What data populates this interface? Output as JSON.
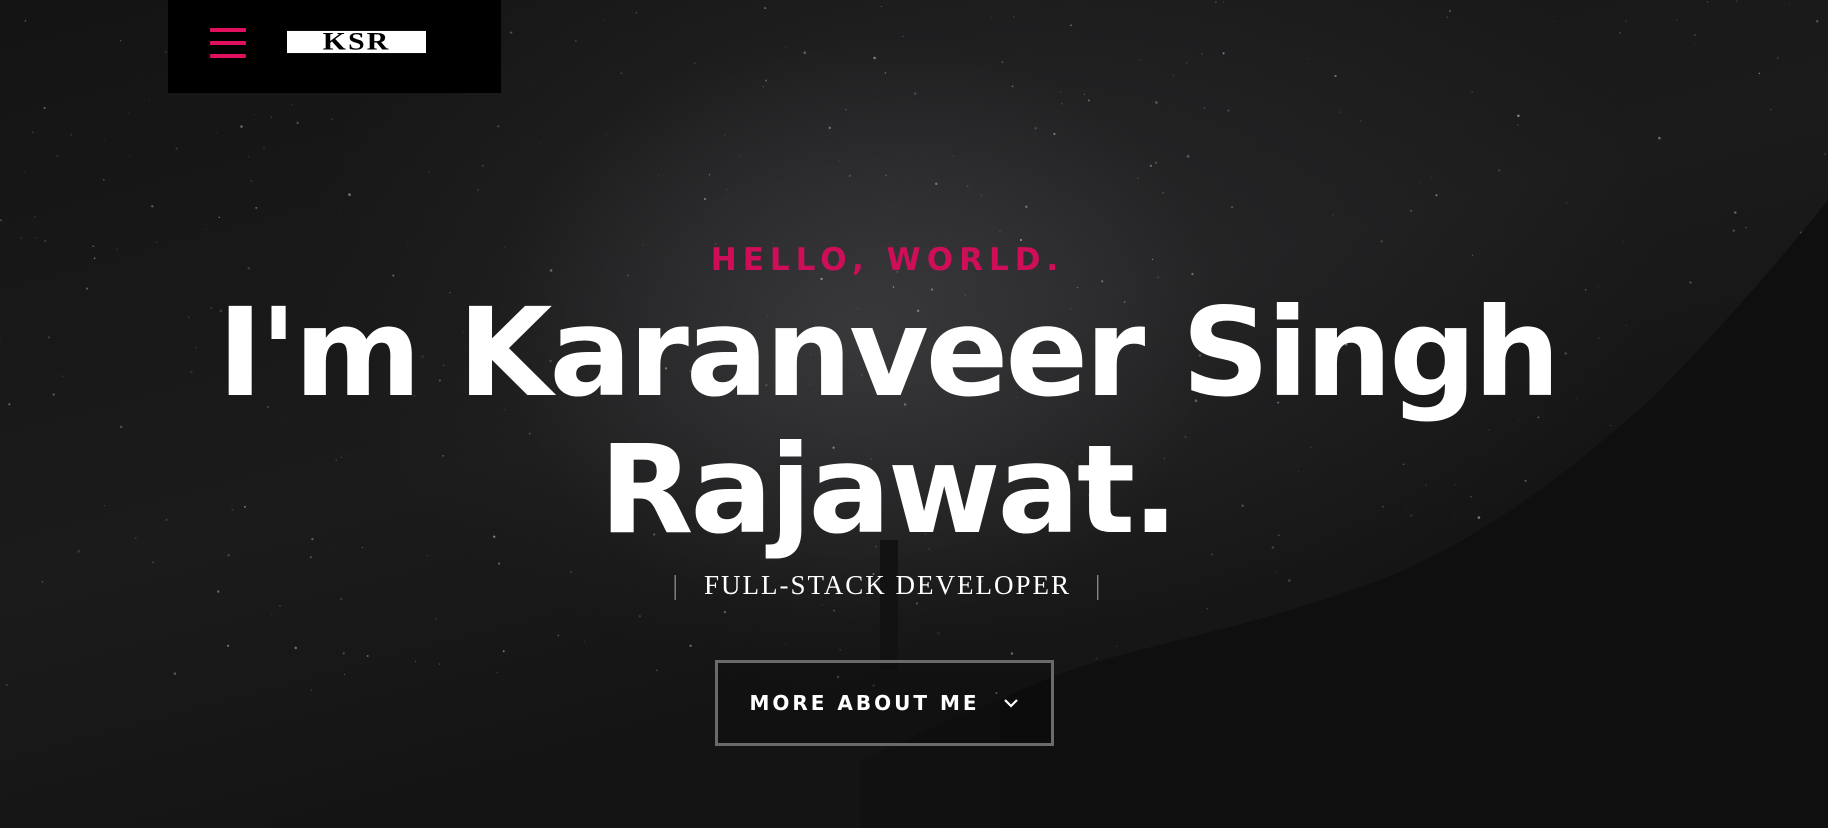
{
  "header": {
    "menu_icon": "hamburger-menu-icon",
    "logo_text": "KSR",
    "accent_color": "#e0105f"
  },
  "hero": {
    "greeting": "HELLO, WORLD.",
    "headline_line1": "I'm Karanveer Singh",
    "headline_line2": "Rajawat.",
    "role_divider": "|",
    "role": "FULL-STACK DEVELOPER",
    "cta_label": "MORE ABOUT ME",
    "cta_icon": "chevron-down-icon"
  }
}
